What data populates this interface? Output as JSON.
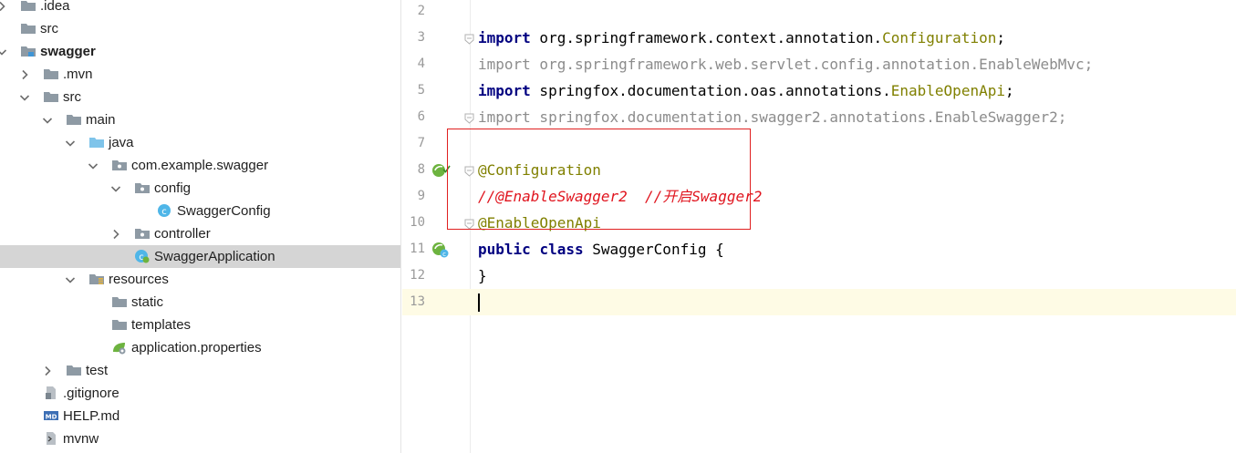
{
  "tree": {
    "items": [
      {
        "label": ".idea",
        "icon": "folder-icon",
        "arrow": "collapsed"
      },
      {
        "label": "src",
        "icon": "folder-icon",
        "arrow": "none"
      },
      {
        "label": "swagger",
        "icon": "module-folder-icon",
        "arrow": "expanded"
      },
      {
        "label": ".mvn",
        "icon": "folder-icon",
        "arrow": "collapsed"
      },
      {
        "label": "src",
        "icon": "folder-icon",
        "arrow": "expanded"
      },
      {
        "label": "main",
        "icon": "folder-icon",
        "arrow": "expanded"
      },
      {
        "label": "java",
        "icon": "source-folder-icon",
        "arrow": "expanded"
      },
      {
        "label": "com.example.swagger",
        "icon": "package-icon",
        "arrow": "expanded"
      },
      {
        "label": "config",
        "icon": "package-icon",
        "arrow": "expanded"
      },
      {
        "label": "SwaggerConfig",
        "icon": "java-class-icon",
        "arrow": "none"
      },
      {
        "label": "controller",
        "icon": "package-icon",
        "arrow": "collapsed"
      },
      {
        "label": "SwaggerApplication",
        "icon": "spring-boot-class-icon",
        "arrow": "none"
      },
      {
        "label": "resources",
        "icon": "resources-folder-icon",
        "arrow": "expanded"
      },
      {
        "label": "static",
        "icon": "folder-icon",
        "arrow": "none"
      },
      {
        "label": "templates",
        "icon": "folder-icon",
        "arrow": "none"
      },
      {
        "label": "application.properties",
        "icon": "spring-properties-icon",
        "arrow": "none"
      },
      {
        "label": "test",
        "icon": "folder-icon",
        "arrow": "collapsed"
      },
      {
        "label": ".gitignore",
        "icon": "gitignore-file-icon",
        "arrow": "none"
      },
      {
        "label": "HELP.md",
        "icon": "markdown-file-icon",
        "arrow": "none"
      },
      {
        "label": "mvnw",
        "icon": "script-file-icon",
        "arrow": "none"
      }
    ]
  },
  "editor": {
    "lines": [
      {
        "num": "2",
        "tokens": []
      },
      {
        "num": "3",
        "tokens": [
          {
            "t": "import",
            "c": "kw"
          },
          {
            "t": " org.springframework.context.annotation.",
            "c": "pkg"
          },
          {
            "t": "Configuration",
            "c": "cls"
          },
          {
            "t": ";",
            "c": "pkg"
          }
        ]
      },
      {
        "num": "4",
        "tokens": [
          {
            "t": "import org.springframework.web.servlet.config.annotation.EnableWebMvc;",
            "c": "unused"
          }
        ]
      },
      {
        "num": "5",
        "tokens": [
          {
            "t": "import",
            "c": "kw"
          },
          {
            "t": " springfox.documentation.oas.annotations.",
            "c": "pkg"
          },
          {
            "t": "EnableOpenApi",
            "c": "cls"
          },
          {
            "t": ";",
            "c": "pkg"
          }
        ]
      },
      {
        "num": "6",
        "tokens": [
          {
            "t": "import springfox.documentation.swagger2.annotations.EnableSwagger2;",
            "c": "unused"
          }
        ]
      },
      {
        "num": "7",
        "tokens": []
      },
      {
        "num": "8",
        "tokens": [
          {
            "t": "@Configuration",
            "c": "anno"
          }
        ]
      },
      {
        "num": "9",
        "tokens": [
          {
            "t": "//@EnableSwagger2  //开启Swagger2",
            "c": "cmt"
          }
        ]
      },
      {
        "num": "10",
        "tokens": [
          {
            "t": "@EnableOpenApi",
            "c": "anno"
          }
        ]
      },
      {
        "num": "11",
        "tokens": [
          {
            "t": "public",
            "c": "kw"
          },
          {
            "t": " ",
            "c": "pkg"
          },
          {
            "t": "class",
            "c": "kw"
          },
          {
            "t": " SwaggerConfig {",
            "c": "pkg"
          }
        ]
      },
      {
        "num": "12",
        "tokens": [
          {
            "t": "}",
            "c": "pkg"
          }
        ]
      },
      {
        "num": "13",
        "tokens": []
      }
    ]
  },
  "colors": {
    "keyword": "#000080",
    "annotation": "#808000",
    "comment": "#e0141e",
    "unused_import": "#8c8c8c",
    "current_line": "#fefbe5",
    "selection": "#d5d5d5",
    "highlight_box": "#e02020"
  }
}
